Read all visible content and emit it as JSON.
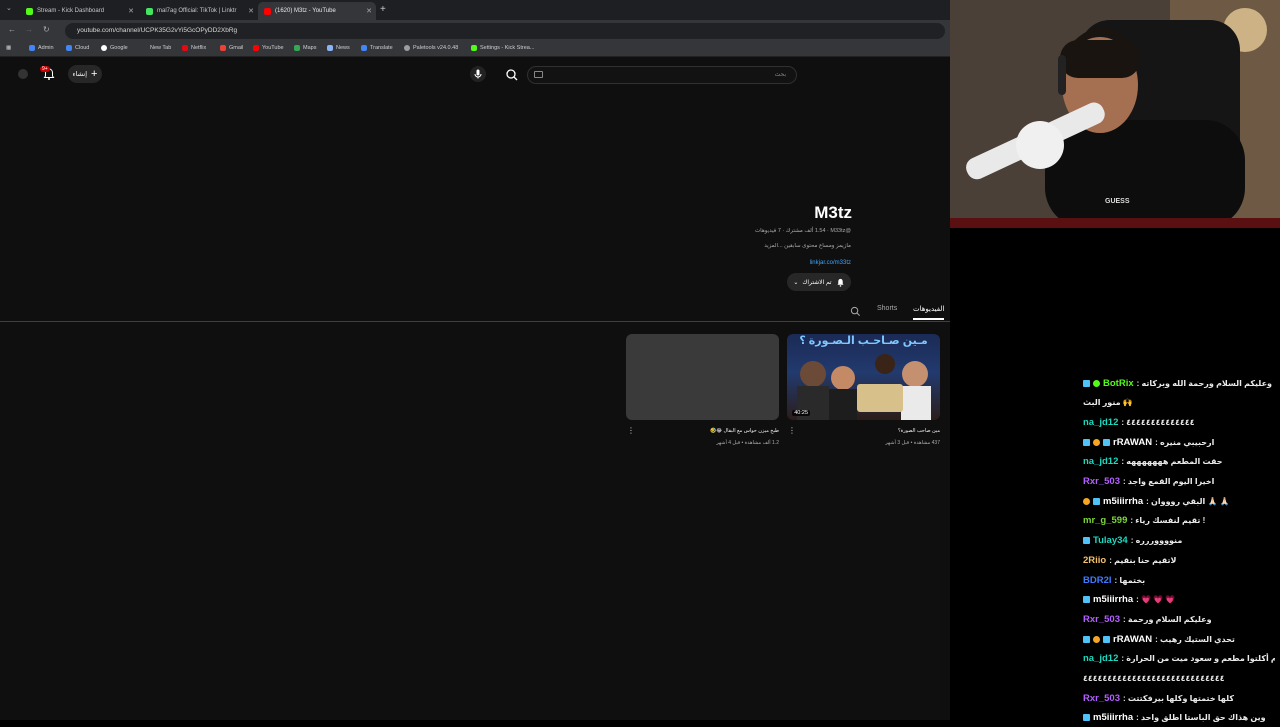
{
  "browser": {
    "tabs": [
      {
        "label": "Stream - Kick Dashboard",
        "color": "#53fc18",
        "active": false
      },
      {
        "label": "mal7ag Official: TikTok | Linktr",
        "color": "#43e660",
        "active": false
      },
      {
        "label": "(1620) M3tz - YouTube",
        "color": "#ff0000",
        "active": true
      }
    ],
    "new_tab": "+",
    "url": "youtube.com/channel/UCPK35G2vYi5GcOPyDD2XbRg",
    "bookmarks": [
      "Admin",
      "Cloud",
      "Google",
      "New Tab",
      "Netflix",
      "Gmail",
      "YouTube",
      "Maps",
      "News",
      "Translate",
      "Paletools v24.0.48",
      "Settings - Kick Strea..."
    ]
  },
  "youtube": {
    "search_placeholder": "بحث",
    "create_label": "إنشاء",
    "notification_count": "9+",
    "channel": {
      "name": "M3tz",
      "stats": "@M33tz · ‏1.54 ألف مشترك · ‏7 فيديوهات",
      "handle": "@M33tz",
      "description": "مازيمز ومساع محتوى سابقين ...المزيد",
      "link": "linkjar.co/m33tz",
      "subscribe_label": "تم الاشتراك"
    },
    "tabs": {
      "videos": "الفيديوهات",
      "shorts": "Shorts"
    },
    "videos": [
      {
        "title": "مين صاحب الصورة؟",
        "meta": "437 مشاهدة • قبل 3 أشهر",
        "duration": "40:25",
        "thumb_text": "مـين صـاحـب الـصـورة ؟"
      },
      {
        "title": "طبخ ميزن حواس مع البقال 😂🤣",
        "meta": "1.2 ألف مشاهدة • قبل 4 أشهر"
      }
    ]
  },
  "webcam": {
    "shirt_text": "GUESS"
  },
  "chat": {
    "messages": [
      {
        "user": "BotRix",
        "color": "#53fc18",
        "text": ": وعليكم السلام ورحمة الله وبركاته",
        "badges": [
          "sq",
          "grn"
        ]
      },
      {
        "user": "",
        "color": "#eaeaea",
        "text": "منور البث 🙌",
        "badges": []
      },
      {
        "user": "na_jd12",
        "color": "#1bd9c0",
        "text": ": ٤٤٤٤٤٤٤٤٤٤٤٤٤٤",
        "badges": []
      },
      {
        "user": "rRAWAN",
        "color": "#ffffff",
        "text": ": ارحبيبي منيره",
        "badges": [
          "sq",
          "circ",
          "sq"
        ]
      },
      {
        "user": "na_jd12",
        "color": "#1bd9c0",
        "text": ": حقت المطعم هههههههه",
        "badges": []
      },
      {
        "user": "Rxr_503",
        "color": "#b45fff",
        "text": ": اخيرا اليوم القمع واجد",
        "badges": []
      },
      {
        "user": "m5iiirrha",
        "color": "#ffffff",
        "text": ": البقي روووان 🙏🏻 🙏🏻",
        "badges": [
          "circ",
          "sq"
        ]
      },
      {
        "user": "mr_g_599",
        "color": "#7cd63b",
        "text": ": تقيم لنفسك رياء !",
        "badges": []
      },
      {
        "user": "Tulay34",
        "color": "#1bd9c0",
        "text": ": منووووررره",
        "badges": [
          "sq"
        ]
      },
      {
        "user": "2Riio",
        "color": "#f5c26b",
        "text": ": لاتقيم حنا بنقيم",
        "badges": []
      },
      {
        "user": "BDR2I",
        "color": "#3e7bff",
        "text": ": بختمها",
        "badges": []
      },
      {
        "user": "m5iiirrha",
        "color": "#ffffff",
        "text": ": 💗 💗 💗",
        "badges": [
          "sq"
        ]
      },
      {
        "user": "Rxr_503",
        "color": "#b45fff",
        "text": ": وعليكم السلام ورحمة",
        "badges": []
      },
      {
        "user": "rRAWAN",
        "color": "#ffffff",
        "text": ": تحدي الستيك رهيب",
        "badges": [
          "sq",
          "circ",
          "sq"
        ]
      },
      {
        "user": "na_jd12",
        "color": "#1bd9c0",
        "text": ": يوم أكلتوا مطعم و سعود ميت من الحرارة",
        "badges": []
      },
      {
        "user": "",
        "color": "#eaeaea",
        "text": "٤٤٤٤٤٤٤٤٤٤٤٤٤٤٤٤٤٤٤٤٤٤٤٤٤٤٤٤٤",
        "badges": []
      },
      {
        "user": "Rxr_503",
        "color": "#b45fff",
        "text": ": كلها ختمتها وكلها بيرفكتتت",
        "badges": []
      },
      {
        "user": "m5iiirrha",
        "color": "#ffffff",
        "text": ": وين هذاك حق الباستا اطلق واحد",
        "badges": [
          "sq"
        ]
      }
    ]
  }
}
